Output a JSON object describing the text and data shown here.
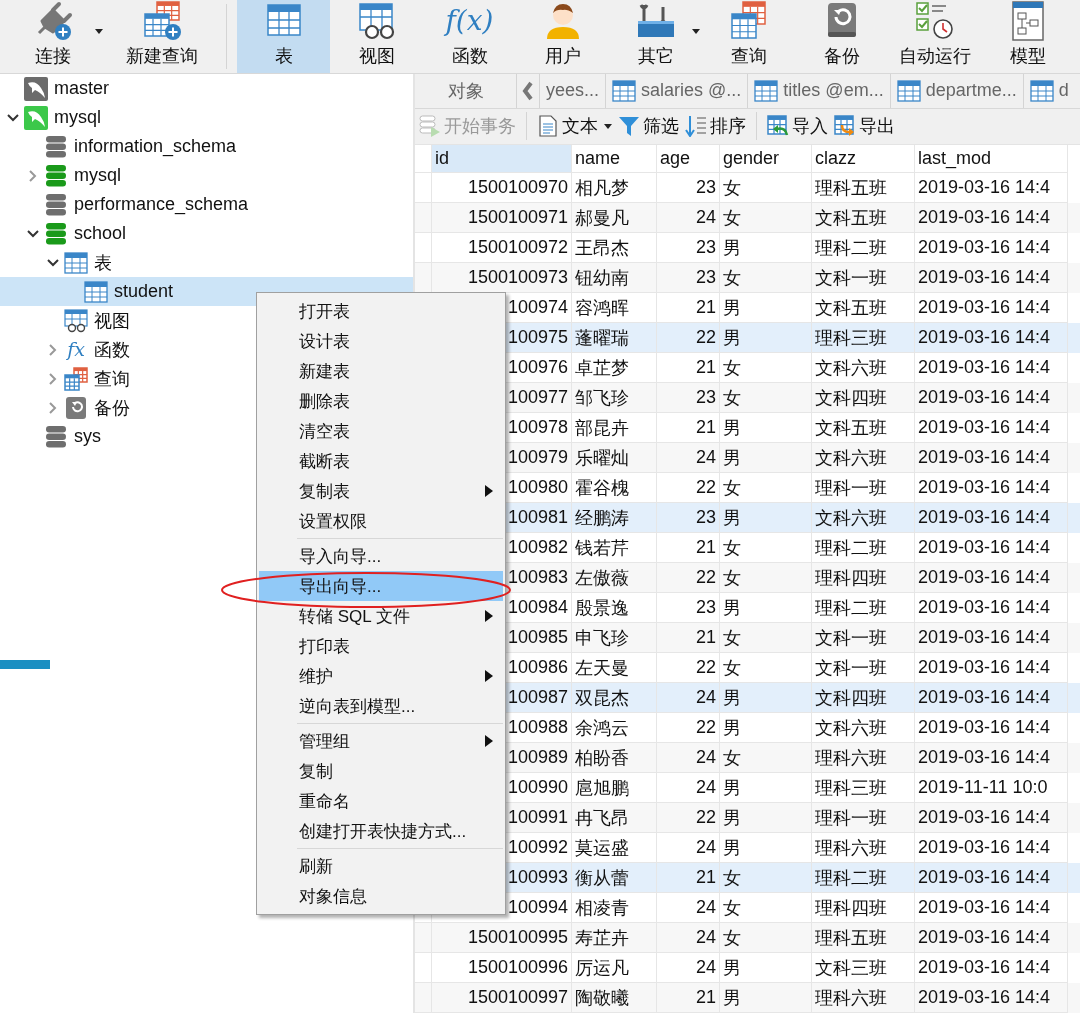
{
  "toolbar": {
    "connection_tools": [
      {
        "label": "连接",
        "kind": "connect",
        "selected": false,
        "dropdown": true
      },
      {
        "label": "新建查询",
        "kind": "newquery",
        "selected": false,
        "dropdown": false
      }
    ],
    "object_tools": [
      {
        "label": "表",
        "kind": "table",
        "selected": true,
        "dropdown": false
      },
      {
        "label": "视图",
        "kind": "view",
        "selected": false,
        "dropdown": false
      },
      {
        "label": "函数",
        "kind": "function",
        "glyph": "f(x)",
        "selected": false,
        "dropdown": false
      },
      {
        "label": "用户",
        "kind": "user",
        "selected": false,
        "dropdown": false
      },
      {
        "label": "其它",
        "kind": "other",
        "selected": false,
        "dropdown": true
      },
      {
        "label": "查询",
        "kind": "query",
        "selected": false,
        "dropdown": false
      },
      {
        "label": "备份",
        "kind": "backup",
        "selected": false,
        "dropdown": false
      },
      {
        "label": "自动运行",
        "kind": "autorun",
        "selected": false,
        "dropdown": false
      },
      {
        "label": "模型",
        "kind": "model",
        "selected": false,
        "dropdown": false
      }
    ]
  },
  "tree": [
    {
      "label": "master",
      "kind": "connection",
      "open": false,
      "selected": false
    },
    {
      "label": "mysql",
      "kind": "connection",
      "open": true,
      "expanded": true,
      "selected": false,
      "children": [
        {
          "label": "information_schema",
          "kind": "database",
          "open": false,
          "selected": false
        },
        {
          "label": "mysql",
          "kind": "database",
          "open": true,
          "expanded": false,
          "selected": false
        },
        {
          "label": "performance_schema",
          "kind": "database",
          "open": false,
          "selected": false
        },
        {
          "label": "school",
          "kind": "database",
          "open": true,
          "expanded": true,
          "selected": false,
          "children": [
            {
              "label": "表",
              "kind": "tables",
              "expanded": true,
              "selected": false,
              "children": [
                {
                  "label": "student",
                  "kind": "table",
                  "selected": true
                }
              ]
            },
            {
              "label": "视图",
              "kind": "views",
              "selected": false
            },
            {
              "label": "函数",
              "kind": "functions",
              "glyph": "fx",
              "expanded": false,
              "selected": false
            },
            {
              "label": "查询",
              "kind": "queries",
              "expanded": false,
              "selected": false
            },
            {
              "label": "备份",
              "kind": "backups",
              "expanded": false,
              "selected": false
            }
          ]
        },
        {
          "label": "sys",
          "kind": "database",
          "open": false,
          "selected": false
        }
      ]
    }
  ],
  "object_tab": {
    "label": "对象",
    "selected": false
  },
  "tabs": [
    {
      "label": "yees...",
      "icon": false,
      "selected": false
    },
    {
      "label": "salaries @...",
      "icon": true,
      "selected": false
    },
    {
      "label": "titles @em...",
      "icon": true,
      "selected": false
    },
    {
      "label": "departme...",
      "icon": true,
      "selected": false
    },
    {
      "label": "d",
      "icon": true,
      "selected": false
    }
  ],
  "sub_toolbar": {
    "groups": [
      [
        {
          "label": "开始事务",
          "kind": "transaction",
          "disabled": true,
          "dropdown": false
        }
      ],
      [
        {
          "label": "文本",
          "kind": "text",
          "disabled": false,
          "dropdown": true
        },
        {
          "label": "筛选",
          "kind": "filter",
          "disabled": false,
          "dropdown": false
        },
        {
          "label": "排序",
          "kind": "sort",
          "disabled": false,
          "dropdown": false
        }
      ],
      [
        {
          "label": "导入",
          "kind": "import",
          "disabled": false,
          "dropdown": false
        },
        {
          "label": "导出",
          "kind": "export",
          "disabled": false,
          "dropdown": false
        }
      ]
    ]
  },
  "table": {
    "columns": [
      {
        "label": "id",
        "selected": true
      },
      {
        "label": "name",
        "selected": false
      },
      {
        "label": "age",
        "selected": false
      },
      {
        "label": "gender",
        "selected": false
      },
      {
        "label": "clazz",
        "selected": false
      },
      {
        "label": "last_mod",
        "selected": false
      }
    ],
    "rows": [
      {
        "id": "1500100970",
        "name": "相凡梦",
        "age": "23",
        "gender": "女",
        "clazz": "理科五班",
        "last_mod": "2019-03-16 14:4",
        "highlighted": false
      },
      {
        "id": "1500100971",
        "name": "郝曼凡",
        "age": "24",
        "gender": "女",
        "clazz": "文科五班",
        "last_mod": "2019-03-16 14:4",
        "highlighted": false
      },
      {
        "id": "1500100972",
        "name": "王昂杰",
        "age": "23",
        "gender": "男",
        "clazz": "理科二班",
        "last_mod": "2019-03-16 14:4",
        "highlighted": false
      },
      {
        "id": "1500100973",
        "name": "钮幼南",
        "age": "23",
        "gender": "女",
        "clazz": "文科一班",
        "last_mod": "2019-03-16 14:4",
        "highlighted": false
      },
      {
        "id": "100974",
        "name": "容鸿晖",
        "age": "21",
        "gender": "男",
        "clazz": "文科五班",
        "last_mod": "2019-03-16 14:4",
        "highlighted": false
      },
      {
        "id": "100975",
        "name": "蓬曜瑞",
        "age": "22",
        "gender": "男",
        "clazz": "理科三班",
        "last_mod": "2019-03-16 14:4",
        "highlighted": true
      },
      {
        "id": "100976",
        "name": "卓芷梦",
        "age": "21",
        "gender": "女",
        "clazz": "文科六班",
        "last_mod": "2019-03-16 14:4",
        "highlighted": false
      },
      {
        "id": "100977",
        "name": "邹飞珍",
        "age": "23",
        "gender": "女",
        "clazz": "文科四班",
        "last_mod": "2019-03-16 14:4",
        "highlighted": false
      },
      {
        "id": "100978",
        "name": "部昆卉",
        "age": "21",
        "gender": "男",
        "clazz": "文科五班",
        "last_mod": "2019-03-16 14:4",
        "highlighted": false
      },
      {
        "id": "100979",
        "name": "乐曜灿",
        "age": "24",
        "gender": "男",
        "clazz": "文科六班",
        "last_mod": "2019-03-16 14:4",
        "highlighted": false
      },
      {
        "id": "100980",
        "name": "霍谷槐",
        "age": "22",
        "gender": "女",
        "clazz": "理科一班",
        "last_mod": "2019-03-16 14:4",
        "highlighted": false
      },
      {
        "id": "100981",
        "name": "经鹏涛",
        "age": "23",
        "gender": "男",
        "clazz": "文科六班",
        "last_mod": "2019-03-16 14:4",
        "highlighted": true
      },
      {
        "id": "100982",
        "name": "钱若芹",
        "age": "21",
        "gender": "女",
        "clazz": "理科二班",
        "last_mod": "2019-03-16 14:4",
        "highlighted": false
      },
      {
        "id": "100983",
        "name": "左傲薇",
        "age": "22",
        "gender": "女",
        "clazz": "理科四班",
        "last_mod": "2019-03-16 14:4",
        "highlighted": false
      },
      {
        "id": "100984",
        "name": "殷景逸",
        "age": "23",
        "gender": "男",
        "clazz": "理科二班",
        "last_mod": "2019-03-16 14:4",
        "highlighted": false
      },
      {
        "id": "100985",
        "name": "申飞珍",
        "age": "21",
        "gender": "女",
        "clazz": "文科一班",
        "last_mod": "2019-03-16 14:4",
        "highlighted": false
      },
      {
        "id": "100986",
        "name": "左天曼",
        "age": "22",
        "gender": "女",
        "clazz": "文科一班",
        "last_mod": "2019-03-16 14:4",
        "highlighted": false
      },
      {
        "id": "100987",
        "name": "双昆杰",
        "age": "24",
        "gender": "男",
        "clazz": "文科四班",
        "last_mod": "2019-03-16 14:4",
        "highlighted": true
      },
      {
        "id": "100988",
        "name": "余鸿云",
        "age": "22",
        "gender": "男",
        "clazz": "文科六班",
        "last_mod": "2019-03-16 14:4",
        "highlighted": false
      },
      {
        "id": "100989",
        "name": "柏盼香",
        "age": "24",
        "gender": "女",
        "clazz": "理科六班",
        "last_mod": "2019-03-16 14:4",
        "highlighted": false
      },
      {
        "id": "100990",
        "name": "扈旭鹏",
        "age": "24",
        "gender": "男",
        "clazz": "理科三班",
        "last_mod": "2019-11-11 10:0",
        "highlighted": false
      },
      {
        "id": "100991",
        "name": "冉飞昂",
        "age": "22",
        "gender": "男",
        "clazz": "理科一班",
        "last_mod": "2019-03-16 14:4",
        "highlighted": false
      },
      {
        "id": "100992",
        "name": "莫运盛",
        "age": "24",
        "gender": "男",
        "clazz": "理科六班",
        "last_mod": "2019-03-16 14:4",
        "highlighted": false
      },
      {
        "id": "100993",
        "name": "衡从蕾",
        "age": "21",
        "gender": "女",
        "clazz": "理科二班",
        "last_mod": "2019-03-16 14:4",
        "highlighted": true
      },
      {
        "id": "100994",
        "name": "相凌青",
        "age": "24",
        "gender": "女",
        "clazz": "理科四班",
        "last_mod": "2019-03-16 14:4",
        "highlighted": false
      },
      {
        "id": "1500100995",
        "name": "寿芷卉",
        "age": "24",
        "gender": "女",
        "clazz": "理科五班",
        "last_mod": "2019-03-16 14:4",
        "highlighted": false
      },
      {
        "id": "1500100996",
        "name": "厉运凡",
        "age": "24",
        "gender": "男",
        "clazz": "文科三班",
        "last_mod": "2019-03-16 14:4",
        "highlighted": false
      },
      {
        "id": "1500100997",
        "name": "陶敬曦",
        "age": "21",
        "gender": "男",
        "clazz": "理科六班",
        "last_mod": "2019-03-16 14:4",
        "highlighted": false
      }
    ]
  },
  "context_menu": {
    "groups": [
      {
        "items": [
          {
            "label": "打开表",
            "selected": false,
            "submenu": false
          },
          {
            "label": "设计表",
            "selected": false,
            "submenu": false
          },
          {
            "label": "新建表",
            "selected": false,
            "submenu": false
          },
          {
            "label": "删除表",
            "selected": false,
            "submenu": false
          },
          {
            "label": "清空表",
            "selected": false,
            "submenu": false
          },
          {
            "label": "截断表",
            "selected": false,
            "submenu": false
          },
          {
            "label": "复制表",
            "selected": false,
            "submenu": true
          },
          {
            "label": "设置权限",
            "selected": false,
            "submenu": false
          }
        ]
      },
      {
        "items": [
          {
            "label": "导入向导...",
            "selected": false,
            "submenu": false
          },
          {
            "label": "导出向导...",
            "selected": true,
            "submenu": false
          },
          {
            "label": "转储 SQL 文件",
            "selected": false,
            "submenu": true
          },
          {
            "label": "打印表",
            "selected": false,
            "submenu": false
          },
          {
            "label": "维护",
            "selected": false,
            "submenu": true
          },
          {
            "label": "逆向表到模型...",
            "selected": false,
            "submenu": false
          }
        ]
      },
      {
        "items": [
          {
            "label": "管理组",
            "selected": false,
            "submenu": true
          },
          {
            "label": "复制",
            "selected": false,
            "submenu": false
          },
          {
            "label": "重命名",
            "selected": false,
            "submenu": false
          },
          {
            "label": "创建打开表快捷方式...",
            "selected": false,
            "submenu": false
          }
        ]
      },
      {
        "items": [
          {
            "label": "刷新",
            "selected": false,
            "submenu": false
          },
          {
            "label": "对象信息",
            "selected": false,
            "submenu": false
          }
        ]
      }
    ]
  }
}
